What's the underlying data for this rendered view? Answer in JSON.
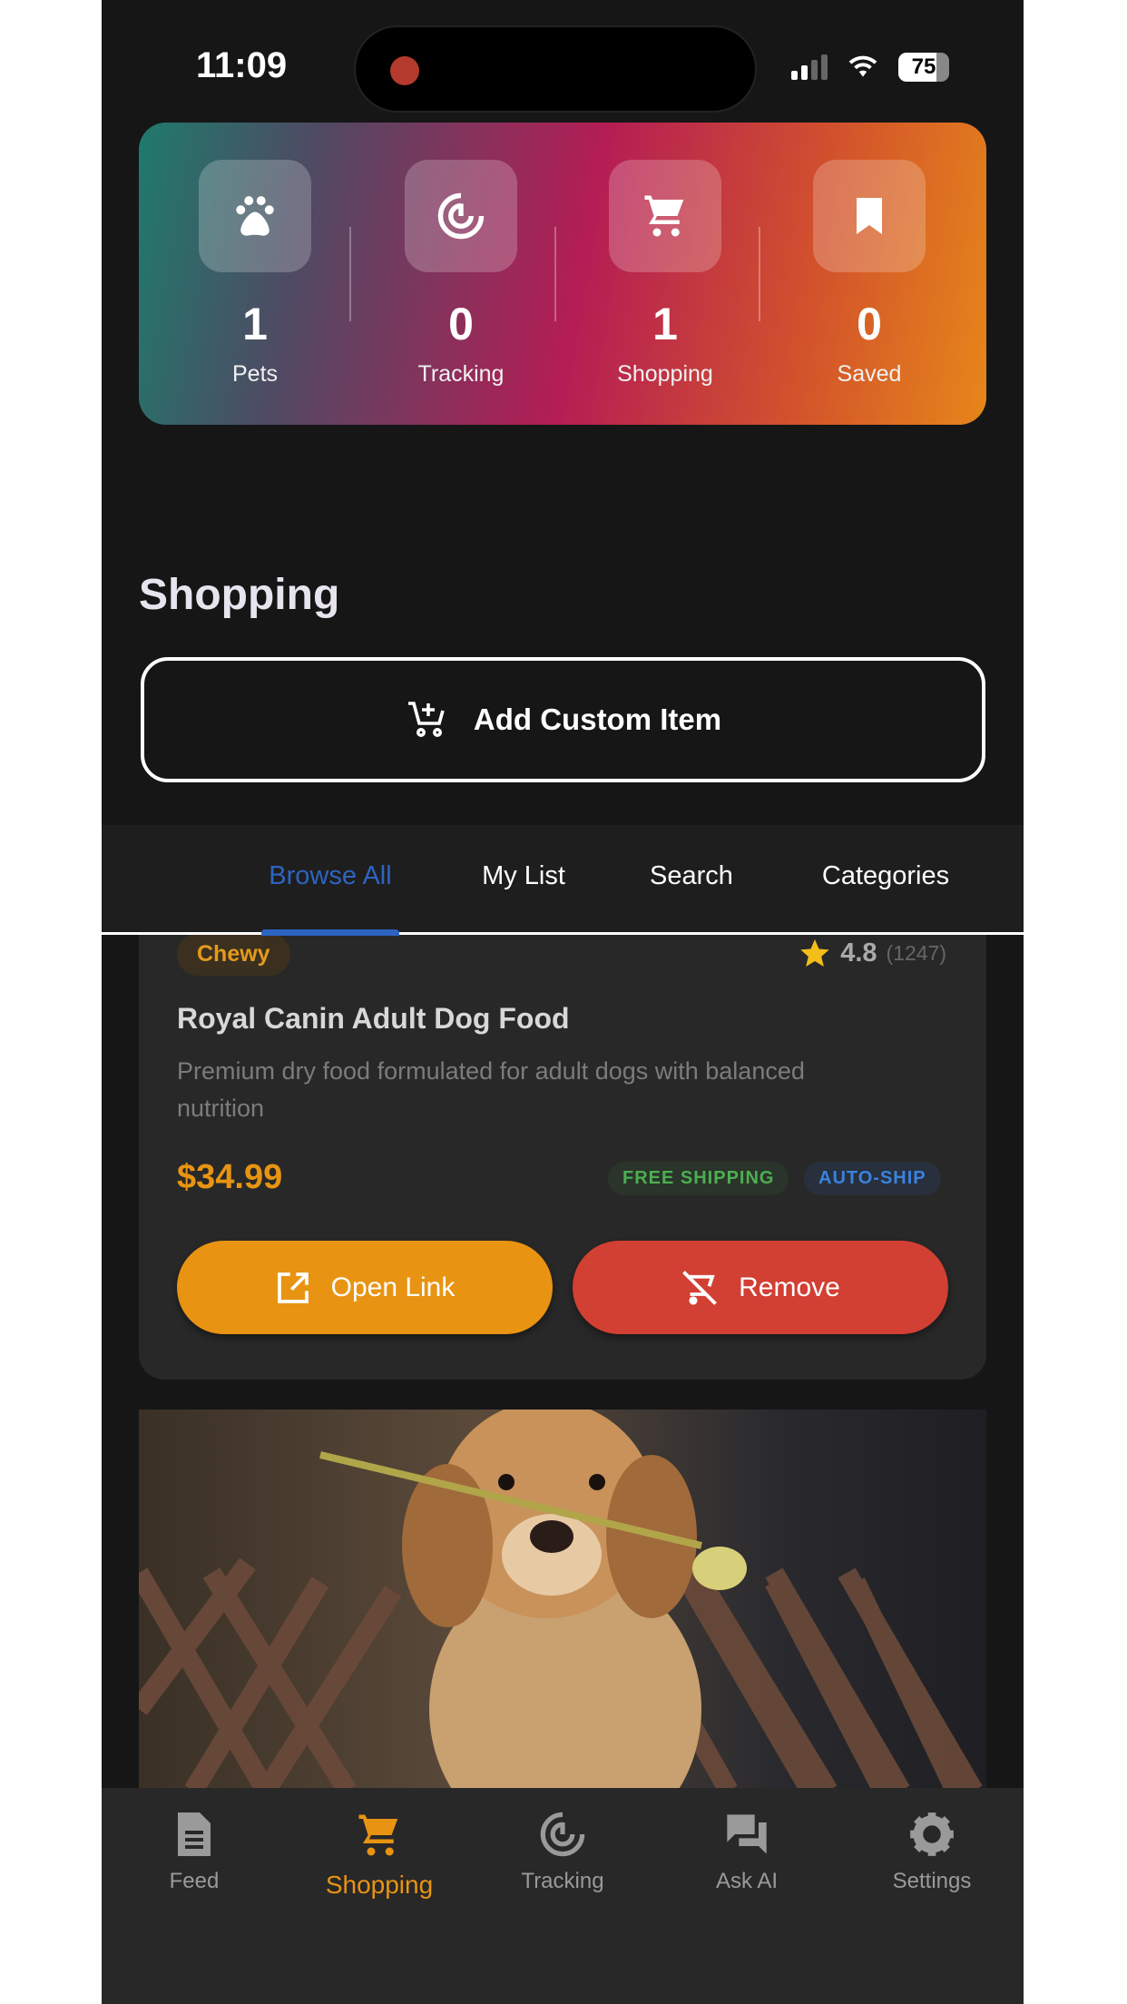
{
  "status_bar": {
    "time": "11:09",
    "battery": "75"
  },
  "stats": [
    {
      "icon": "paw-icon",
      "value": "1",
      "label": "Pets"
    },
    {
      "icon": "radar-icon",
      "value": "0",
      "label": "Tracking"
    },
    {
      "icon": "cart-icon",
      "value": "1",
      "label": "Shopping"
    },
    {
      "icon": "bookmark-icon",
      "value": "0",
      "label": "Saved"
    }
  ],
  "section_title": "Shopping",
  "add_button": "Add Custom Item",
  "tabs": [
    {
      "label": "Browse All",
      "active": true
    },
    {
      "label": "My List"
    },
    {
      "label": "Search"
    },
    {
      "label": "Categories"
    }
  ],
  "product": {
    "store": "Chewy",
    "rating": "4.8",
    "reviews": "(1247)",
    "title": "Royal Canin Adult Dog Food",
    "description": "Premium dry food formulated for adult dogs with balanced nutrition",
    "price": "$34.99",
    "badges": [
      "FREE SHIPPING",
      "AUTO-SHIP"
    ],
    "open_label": "Open Link",
    "remove_label": "Remove"
  },
  "nav": [
    {
      "label": "Feed"
    },
    {
      "label": "Shopping",
      "active": true
    },
    {
      "label": "Tracking"
    },
    {
      "label": "Ask AI"
    },
    {
      "label": "Settings"
    }
  ],
  "colors": {
    "accent": "#e89412",
    "tab_active": "#2d64c2",
    "remove": "#d23f33"
  }
}
